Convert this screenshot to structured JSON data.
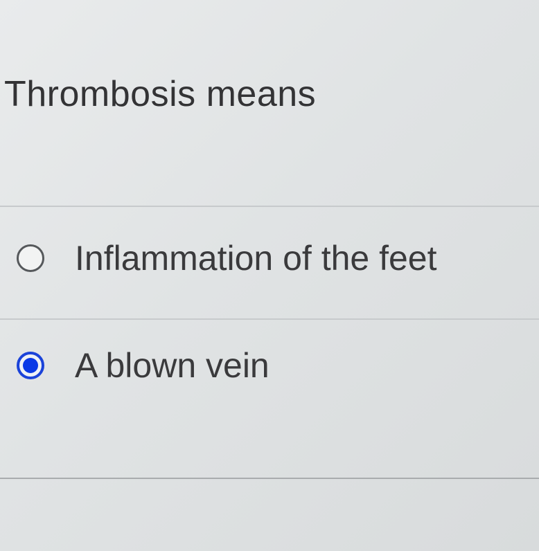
{
  "question": {
    "text": "Thrombosis means"
  },
  "options": [
    {
      "label": "Inflammation of the feet",
      "selected": false
    },
    {
      "label": "A blown vein",
      "selected": true
    }
  ],
  "colors": {
    "radio_selected": "#0a39e6",
    "radio_border": "#55585b",
    "text": "#3a3a3c"
  }
}
